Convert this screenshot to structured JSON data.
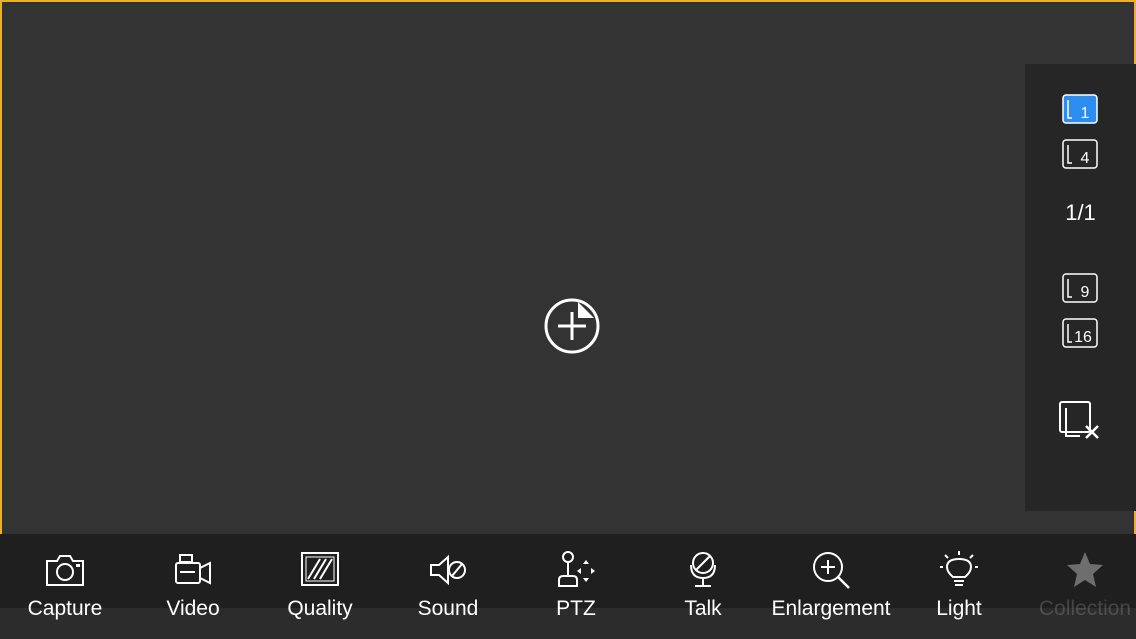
{
  "colors": {
    "background": "#333333",
    "selection_border": "#f0ad28",
    "active_layout": "#2d8cf0",
    "panel": "#262626",
    "toolbar": "#1f1f1f",
    "text": "#ffffff"
  },
  "video": {
    "add_icon": "add-camera-icon"
  },
  "side_panel": {
    "layouts": [
      {
        "label": "1",
        "active": true
      },
      {
        "label": "4",
        "active": false
      },
      {
        "label": "9",
        "active": false
      },
      {
        "label": "16",
        "active": false
      }
    ],
    "page_indicator": "1/1",
    "close_all_icon": "close-all-windows-icon"
  },
  "toolbar": {
    "items": [
      {
        "label": "Capture",
        "icon": "camera-icon"
      },
      {
        "label": "Video",
        "icon": "video-camera-icon"
      },
      {
        "label": "Quality",
        "icon": "quality-icon"
      },
      {
        "label": "Sound",
        "icon": "speaker-muted-icon"
      },
      {
        "label": "PTZ",
        "icon": "ptz-joystick-icon"
      },
      {
        "label": "Talk",
        "icon": "microphone-off-icon"
      },
      {
        "label": "Enlargement",
        "icon": "zoom-in-icon"
      },
      {
        "label": "Light",
        "icon": "light-bulb-icon"
      },
      {
        "label": "Collection",
        "icon": "star-icon"
      }
    ]
  }
}
